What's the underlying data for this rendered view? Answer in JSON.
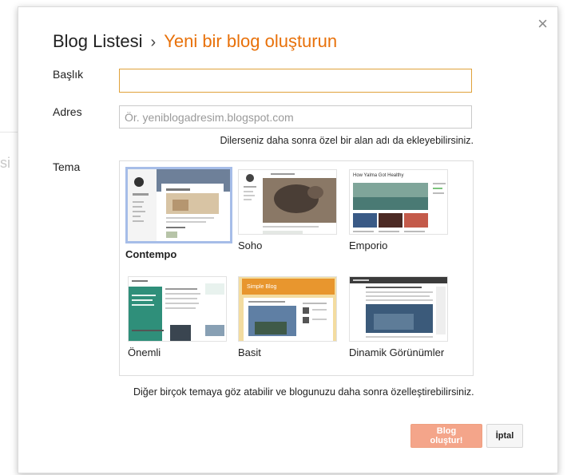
{
  "background": {
    "hint_text": "si"
  },
  "dialog": {
    "close_glyph": "×",
    "breadcrumb": {
      "parent": "Blog Listesi",
      "separator": "›",
      "current": "Yeni bir blog oluşturun"
    },
    "title_field": {
      "label": "Başlık",
      "value": "",
      "placeholder": ""
    },
    "address_field": {
      "label": "Adres",
      "value": "",
      "placeholder": "Ör. yeniblogadresim.blogspot.com",
      "hint": "Dilerseniz daha sonra özel bir alan adı da ekleyebilirsiniz."
    },
    "theme": {
      "label": "Tema",
      "selected": "Contempo",
      "options": [
        {
          "name": "Contempo",
          "thumb_title": "What's new Today"
        },
        {
          "name": "Soho",
          "thumb_title": ""
        },
        {
          "name": "Emporio",
          "thumb_title": "How Yalma Got Healthy"
        },
        {
          "name": "Önemli",
          "thumb_title": ""
        },
        {
          "name": "Basit",
          "thumb_title": "Simple Blog"
        },
        {
          "name": "Dinamik Görünümler",
          "thumb_title": ""
        }
      ],
      "footer_hint": "Diğer birçok temaya göz atabilir ve blogunuzu daha sonra özelleştirebilirsiniz."
    },
    "buttons": {
      "create": "Blog oluştur!",
      "cancel": "İptal"
    }
  },
  "colors": {
    "accent_orange": "#e8710a",
    "create_button": "#f4a58a",
    "focus_border": "#e0a23a",
    "selected_theme_border": "#a6bde8"
  }
}
